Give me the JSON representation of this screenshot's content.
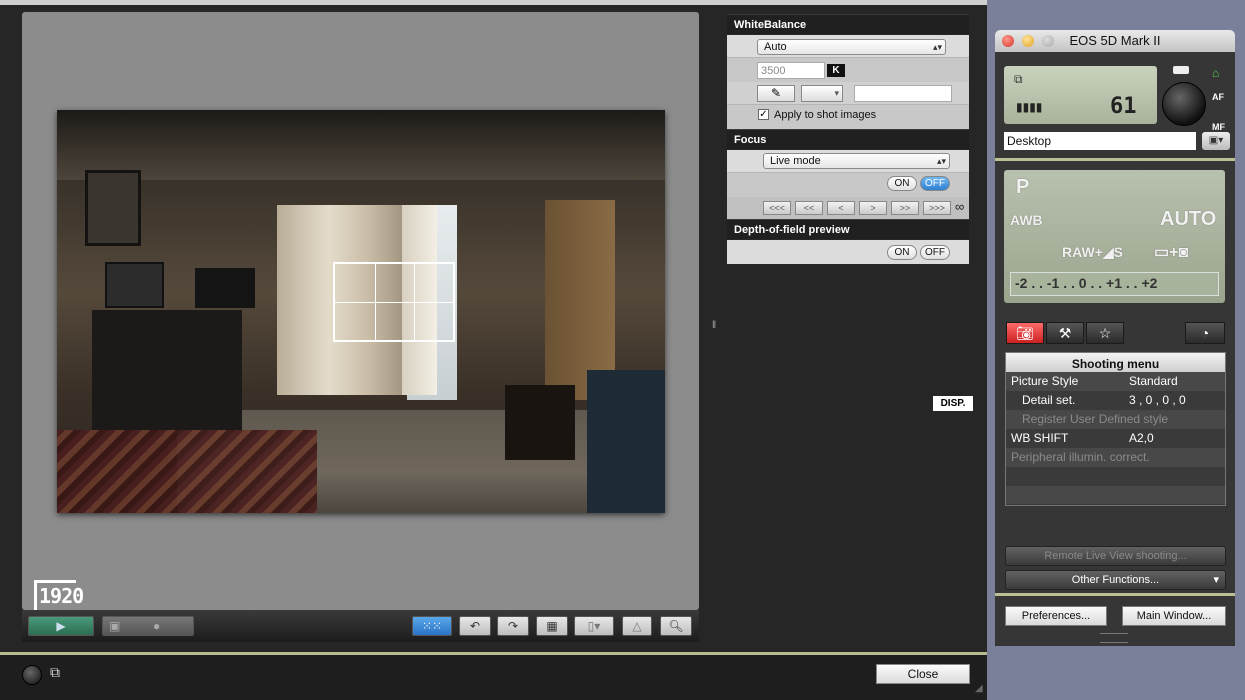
{
  "live_view": {
    "photo_logo": "1920",
    "close_label": "Close",
    "disp_label": "DISP."
  },
  "white_balance": {
    "header": "WhiteBalance",
    "mode": "Auto",
    "kelvin_value": "3500",
    "kelvin_unit": "K",
    "apply_label": "Apply to shot images"
  },
  "focus": {
    "header": "Focus",
    "mode": "Live mode",
    "on_label": "ON",
    "off_label": "OFF",
    "nav": [
      "<<<",
      "<<",
      "<",
      ">",
      ">>",
      ">>>"
    ],
    "infinity": "∞"
  },
  "dof": {
    "header": "Depth-of-field preview",
    "on_label": "ON",
    "off_label": "OFF"
  },
  "camera": {
    "title": "EOS 5D Mark II",
    "shots_remaining": "61",
    "destination": "Desktop",
    "mode": "P",
    "wb": "AWB",
    "iso": "AUTO",
    "quality": "RAW+◢S",
    "exposure_scale": "-2 . . -1 . . 0 . . +1 . . +2",
    "af_label": "AF",
    "mf_label": "MF",
    "menu": {
      "title": "Shooting menu",
      "rows": [
        {
          "k": "Picture Style",
          "v": "Standard"
        },
        {
          "k": "Detail set.",
          "v": "3 , 0 , 0 , 0"
        },
        {
          "k": "Register User Defined style",
          "v": ""
        },
        {
          "k": "WB SHIFT",
          "v": "A2,0"
        },
        {
          "k": "Peripheral illumin. correct.",
          "v": ""
        }
      ]
    },
    "remote_label": "Remote Live View shooting...",
    "other_label": "Other Functions...",
    "prefs_label": "Preferences...",
    "main_label": "Main Window..."
  }
}
